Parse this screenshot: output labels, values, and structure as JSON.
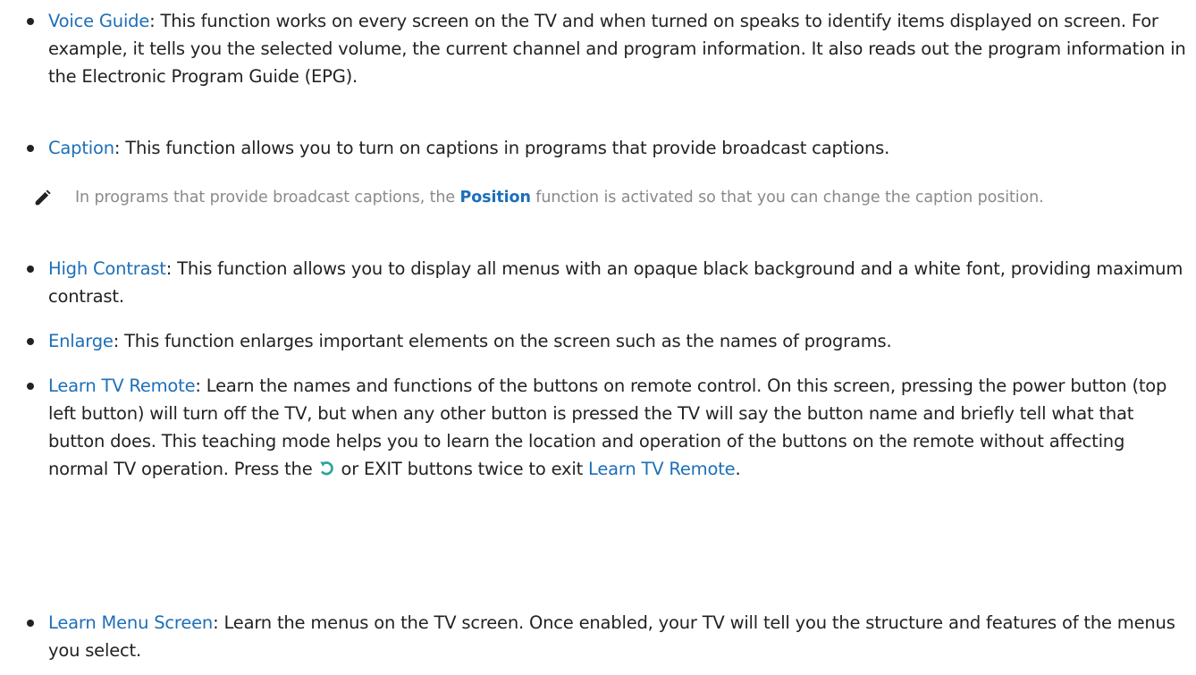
{
  "items": [
    {
      "term": "Voice Guide",
      "sep": ": ",
      "desc": "This function works on every screen on the TV and when turned on speaks to identify items displayed on screen. For example, it tells you the selected volume, the current channel and program information. It also reads out the program information in the Electronic Program Guide (EPG)."
    },
    {
      "term": "Caption",
      "sep": ": ",
      "desc": "This function allows you to turn on captions in programs that provide broadcast captions."
    },
    {
      "term": "High Contrast",
      "sep": ": ",
      "desc": "This function allows you to display all menus with an opaque black background and a white font, providing maximum contrast."
    },
    {
      "term": "Enlarge",
      "sep": ": ",
      "desc": "This function enlarges important elements on the screen such as the names of programs."
    },
    {
      "term": "Learn TV Remote",
      "sep": ": ",
      "desc_a": "Learn the names and functions of the buttons on remote control. On this screen, pressing the power button (top left button) will turn off the TV, but when any other button is pressed the TV will say the button name and briefly tell what that button does. This teaching mode helps you to learn the location and operation of the buttons on the remote without affecting normal TV operation. Press the ",
      "desc_b": " or EXIT buttons twice to exit ",
      "desc_c": "."
    },
    {
      "term": "Learn Menu Screen",
      "sep": ": ",
      "desc": "Learn the menus on the TV screen. Once enabled, your TV will tell you the structure and features of the menus you select."
    }
  ],
  "note": {
    "before": "In programs that provide broadcast captions, the ",
    "term": "Position",
    "after": " function is activated so that you can change the caption position."
  },
  "icons": {
    "note": "pencil-icon",
    "return": "return-icon"
  },
  "colors": {
    "link": "#1d6fb8",
    "note_text": "#8a8a8a",
    "body_text": "#222222",
    "return_icon": "#2aa59a"
  }
}
